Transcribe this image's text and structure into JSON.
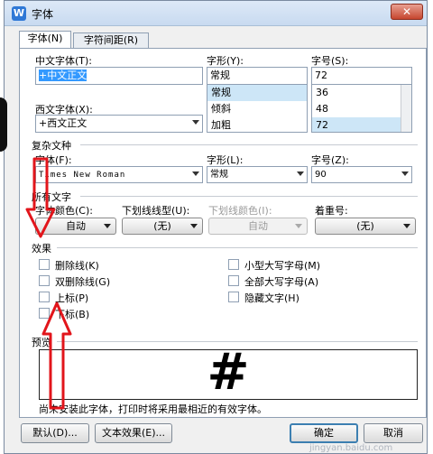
{
  "window": {
    "title": "字体",
    "app_icon": "W"
  },
  "tabs": [
    {
      "label": "字体(N)"
    },
    {
      "label": "字符间距(R)"
    }
  ],
  "chinese_font": {
    "label": "中文字体(T):",
    "value": "+中文正文"
  },
  "font_style": {
    "label": "字形(Y):",
    "value": "常规",
    "options": [
      "常规",
      "倾斜",
      "加粗"
    ],
    "selected_index": 0
  },
  "font_size": {
    "label": "字号(S):",
    "value": "72",
    "options": [
      "36",
      "48",
      "72"
    ],
    "selected_index": 2
  },
  "western_font": {
    "label": "西文字体(X):",
    "value": "+西文正文"
  },
  "complex": {
    "section_title": "复杂文种",
    "font_label": "字体(F):",
    "font_value": "Times New Roman",
    "style_label": "字形(L):",
    "style_value": "常规",
    "size_label": "字号(Z):",
    "size_value": "90"
  },
  "all_text": {
    "section_title": "所有文字",
    "color_label": "字体颜色(C):",
    "color_value": "自动",
    "underline_label": "下划线线型(U):",
    "underline_value": "(无)",
    "underline_color_label": "下划线颜色(I):",
    "underline_color_value": "自动",
    "emphasis_label": "着重号:",
    "emphasis_value": "(无)"
  },
  "effects": {
    "section_title": "效果",
    "left": [
      "删除线(K)",
      "双删除线(G)",
      "上标(P)",
      "下标(B)"
    ],
    "right": [
      "小型大写字母(M)",
      "全部大写字母(A)",
      "隐藏文字(H)"
    ]
  },
  "preview": {
    "section_title": "预览",
    "sample": "#",
    "note": "尚未安装此字体，打印时将采用最相近的有效字体。"
  },
  "buttons": {
    "default": "默认(D)...",
    "text_effects": "文本效果(E)...",
    "ok": "确定",
    "cancel": "取消"
  },
  "colors": {
    "arrow": "#e2151b",
    "selection": "#3399ff"
  },
  "watermark": "jingyan.baidu.com"
}
